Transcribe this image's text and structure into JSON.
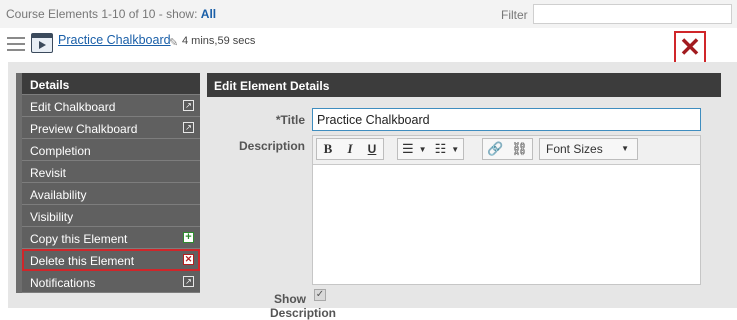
{
  "topbar": {
    "summary_prefix": "Course Elements 1-10 of 10 - show:",
    "show_link": "All",
    "filter_label": "Filter",
    "filter_value": ""
  },
  "element": {
    "title": "Practice Chalkboard",
    "duration": "4 mins,59 secs"
  },
  "sidebar": {
    "header": "Details",
    "items": [
      {
        "label": "Edit Chalkboard",
        "action": "external"
      },
      {
        "label": "Preview Chalkboard",
        "action": "external"
      },
      {
        "label": "Completion",
        "action": ""
      },
      {
        "label": "Revisit",
        "action": ""
      },
      {
        "label": "Availability",
        "action": ""
      },
      {
        "label": "Visibility",
        "action": ""
      },
      {
        "label": "Copy this Element",
        "action": "add"
      },
      {
        "label": "Delete this Element",
        "action": "delete"
      },
      {
        "label": "Notifications",
        "action": "external"
      }
    ]
  },
  "details": {
    "header": "Edit Element Details",
    "title_label": "*Title",
    "title_value": "Practice Chalkboard",
    "description_label": "Description",
    "font_sizes": "Font Sizes",
    "show_label": "Show Description"
  },
  "colors": {
    "link": "#1a5fa8",
    "highlight": "#d0262a",
    "sidebar_bg": "#606060",
    "header_bg": "#3c3c3c"
  }
}
